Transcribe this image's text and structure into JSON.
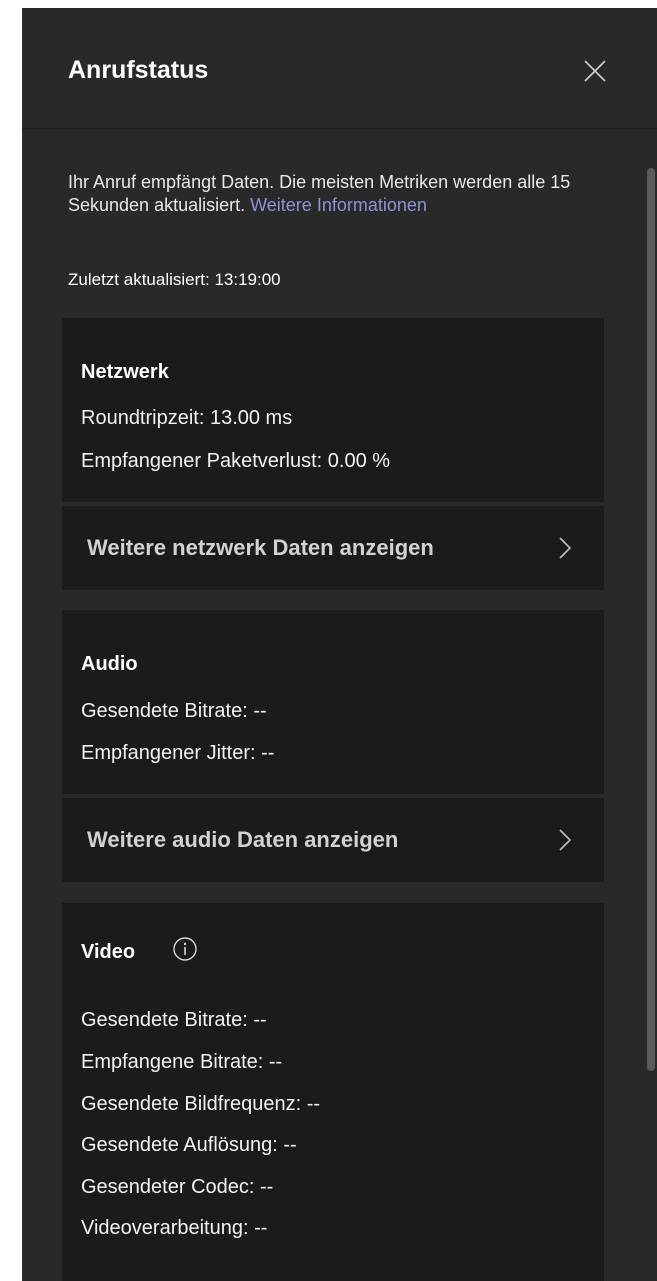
{
  "panel": {
    "title": "Anrufstatus",
    "intro_text": "Ihr Anruf empfängt Daten. Die meisten Metriken werden alle 15 Sekunden aktualisiert.",
    "intro_link": "Weitere Informationen",
    "last_updated": "Zuletzt aktualisiert: 13:19:00"
  },
  "network": {
    "title": "Netzwerk",
    "metrics": [
      "Roundtripzeit: 13.00 ms",
      "Empfangener Paketverlust: 0.00 %"
    ],
    "more_label": "Weitere netzwerk Daten anzeigen"
  },
  "audio": {
    "title": "Audio",
    "metrics": [
      "Gesendete Bitrate: --",
      "Empfangener Jitter: --"
    ],
    "more_label": "Weitere audio Daten anzeigen"
  },
  "video": {
    "title": "Video",
    "metrics": [
      "Gesendete Bitrate: --",
      "Empfangene Bitrate: --",
      "Gesendete Bildfrequenz: --",
      "Gesendete Auflösung: --",
      "Gesendeter Codec: --",
      "Videoverarbeitung: --"
    ]
  },
  "icons": {
    "close": "close-icon",
    "chevron": "chevron-right-icon",
    "info": "info-icon"
  },
  "colors": {
    "panel_bg": "#292929",
    "card_bg": "#1b1b1b",
    "link": "#8e92d6",
    "text": "#ffffff"
  }
}
